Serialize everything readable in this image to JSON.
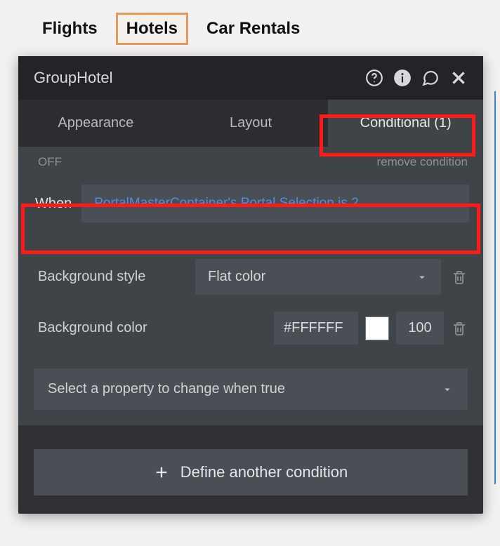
{
  "page_tabs": {
    "flights": "Flights",
    "hotels": "Hotels",
    "car_rentals": "Car Rentals"
  },
  "inspector": {
    "title": "GroupHotel",
    "tabs": {
      "appearance": "Appearance",
      "layout": "Layout",
      "conditional": "Conditional (1)"
    },
    "condition": {
      "off_label": "OFF",
      "remove_label": "remove condition",
      "when_label": "When",
      "expression": "PortalMasterContainer's Portal Selection is 2"
    },
    "bg_style": {
      "label": "Background style",
      "value": "Flat color"
    },
    "bg_color": {
      "label": "Background color",
      "hex": "#FFFFFF",
      "opacity": "100"
    },
    "property_select_placeholder": "Select a property to change when true",
    "define_another": "Define another condition"
  }
}
